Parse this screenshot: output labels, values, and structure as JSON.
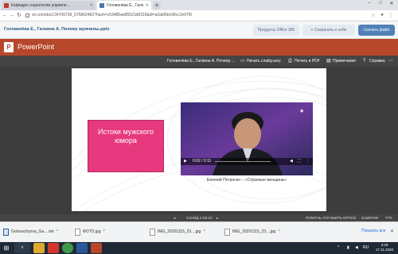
{
  "browser": {
    "tabs": [
      {
        "label": "Кафедра социологии управле...",
        "active": false
      },
      {
        "label": "Головачёва Е., Галкина А. Почем",
        "active": true
      }
    ],
    "url": "vk.com/doc134706728_575862482?hash=c53485ae85521d6315&dl=a2abf5bc08cc2e97f0"
  },
  "doc_header": {
    "title": "Головачёва Е., Галкина А. Почему мужчины.pptx",
    "office_button": "Продукты Office 365",
    "save_button": "+ Сохранить к себе",
    "download_button": "Скачать файл"
  },
  "ppt": {
    "app_name": "PowerPoint",
    "doc_name": "Головачёва Е., Галкина А. Почему ...",
    "toolbar": {
      "slideshow": "Начать слайд-шоу",
      "print": "Печать в PDF",
      "notes": "Примечания",
      "help": "Справка"
    }
  },
  "slide": {
    "heading": "Истоки мужского юмора",
    "video": {
      "time": "0:02 / 0:11"
    },
    "caption": "Евгений Петросян – «Странные женщины»"
  },
  "status": {
    "slide_counter": "СЛАЙД 2 ИЗ 10",
    "help_improve": "ПОМОЧЬ УЛУЧШИТЬ OFFICE",
    "notes": "ЗАМЕТКИ",
    "zoom": "77%"
  },
  "downloads": [
    {
      "name": "Golovachyova_Ga....ont",
      "type": "doc"
    },
    {
      "name": "ФОТО.jpg",
      "type": "img"
    },
    {
      "name": "IMG_20201115_23....jpg",
      "type": "img"
    },
    {
      "name": "IMG_20201115_23....jpg",
      "type": "img"
    }
  ],
  "downloads_show_all": "Показать все",
  "taskbar": {
    "lang": "RU",
    "time": "4:29",
    "date": "17.11.2020"
  },
  "colors": {
    "ppt_red": "#b7472a",
    "pink_box": "#e6397e",
    "vk_blue": "#5181b8"
  }
}
